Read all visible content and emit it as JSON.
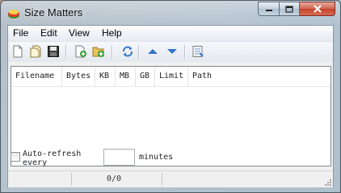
{
  "window": {
    "title": "Size Matters",
    "icon": "app-icon",
    "controls": [
      "minimize-icon",
      "maximize-icon",
      "close-icon"
    ]
  },
  "menu": {
    "file": "File",
    "edit": "Edit",
    "view": "View",
    "help": "Help"
  },
  "toolbar": {
    "buttons": [
      "new-file-icon",
      "open-folder-icon",
      "save-icon",
      "add-file-icon",
      "add-folder-icon",
      "refresh-icon",
      "move-up-icon",
      "move-down-icon",
      "properties-icon"
    ]
  },
  "list": {
    "columns": [
      "Filename",
      "Bytes",
      "KB",
      "MB",
      "GB",
      "Limit",
      "Path"
    ],
    "rows": []
  },
  "options": {
    "auto_refresh_label": "Auto-refresh every",
    "auto_refresh_checked": false,
    "minutes_value": "",
    "minutes_label": "minutes"
  },
  "status": {
    "count": "0/0"
  },
  "colors": {
    "close_button": "#c4432b",
    "toolbar_arrows": "#2f74c9"
  }
}
